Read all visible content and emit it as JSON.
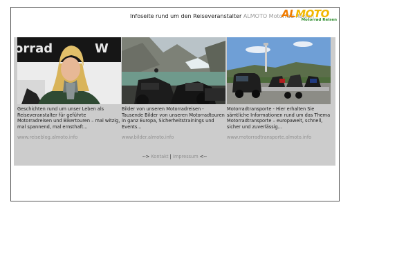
{
  "header": {
    "text_prefix": "Infoseite rund um den Reiseveranstalter",
    "brand_link": "ALMOTO Motorrad Reisen"
  },
  "logo": {
    "part1": "AL",
    "part2": "MOTO",
    "tagline": "Motorrad Reisen",
    "color_al": "#f07b00",
    "color_moto": "#f2b800",
    "color_tagline": "#2a8a2a"
  },
  "columns": [
    {
      "description": "Geschichten rund um unser Leben als Reiseveranstalter für geführte Motorradreisen und Bikertouren – mal witzig, mal spannend, mal ernsthaft...",
      "url": "www.reiseblog.almoto.info"
    },
    {
      "description": "Bilder von unseren Motorradreisen - Tausende Bilder von unseren Motorradtouren in ganz Europa, Sicherheitstrainings und Events...",
      "url": "www.bilder.almoto.info"
    },
    {
      "description": "Motorradtransporte - Hier erhalten Sie sämtliche Informationen rund um das Thema Motorradtransporte – europaweit, schnell, sicher und zuverlässig...",
      "url": "www.motorradtransporte.almoto.info"
    }
  ],
  "footer": {
    "arrow_left": "-->",
    "link_kontakt": "Kontakt",
    "separator": "|",
    "link_impressum": "Impressum",
    "arrow_right": "<--"
  },
  "colors": {
    "panel_bg": "#cccccc",
    "link_gray": "#8f8f8f",
    "frame_border": "#555555"
  }
}
